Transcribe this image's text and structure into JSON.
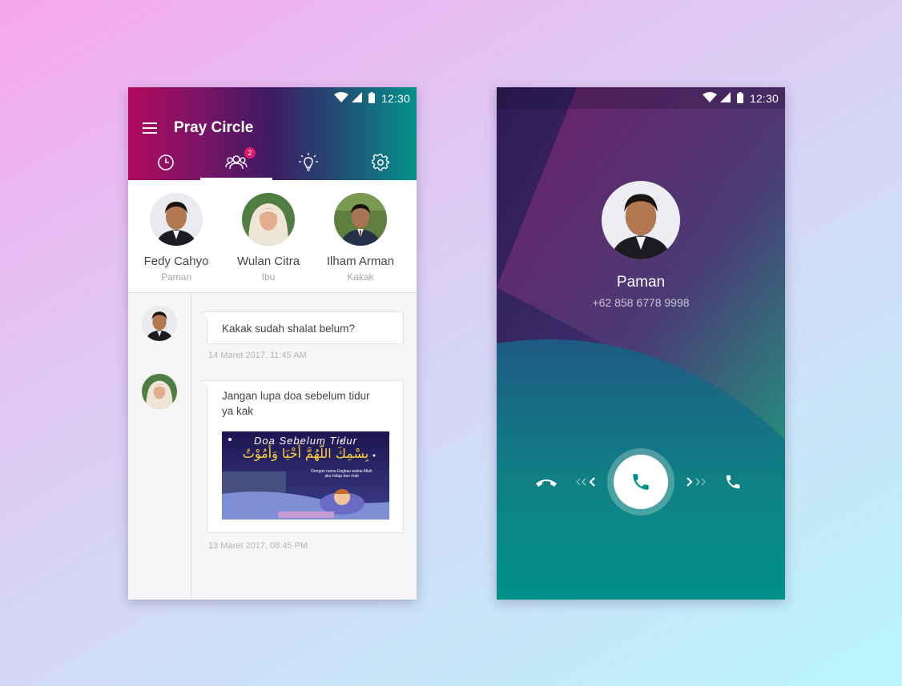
{
  "status_bar": {
    "time": "12:30"
  },
  "left": {
    "app_title": "Pray Circle",
    "tabs": [
      {
        "name": "history",
        "icon": "clock-icon"
      },
      {
        "name": "people",
        "icon": "group-icon",
        "badge": "2"
      },
      {
        "name": "ideas",
        "icon": "lightbulb-icon"
      },
      {
        "name": "settings",
        "icon": "gear-icon"
      }
    ],
    "contacts": [
      {
        "name": "Fedy Cahyo",
        "relation": "Paman"
      },
      {
        "name": "Wulan Citra",
        "relation": "Ibu"
      },
      {
        "name": "Ilham Arman",
        "relation": "Kakak"
      }
    ],
    "messages": [
      {
        "text": "Kakak sudah shalat belum?",
        "timestamp": "14 Maret 2017. 11:45 AM"
      },
      {
        "text": "Jangan lupa doa sebelum tidur ya kak",
        "timestamp": "13 Maret 2017.  08:45 PM",
        "image": {
          "title": "Doa Sebelum Tidur",
          "arabic": "بِسْمِكَ اللّهُمَّ أَحْيَا وَأَمُوْتُ",
          "caption_1": "Dengan nama Engkau wahai Allah",
          "caption_2": "aku hidup dan mati"
        }
      }
    ]
  },
  "right": {
    "caller_name": "Paman",
    "caller_number": "+62 858 6778 9998"
  },
  "colors": {
    "accent_pink": "#e3196f",
    "teal": "#00908a",
    "purple": "#3c1b63"
  }
}
